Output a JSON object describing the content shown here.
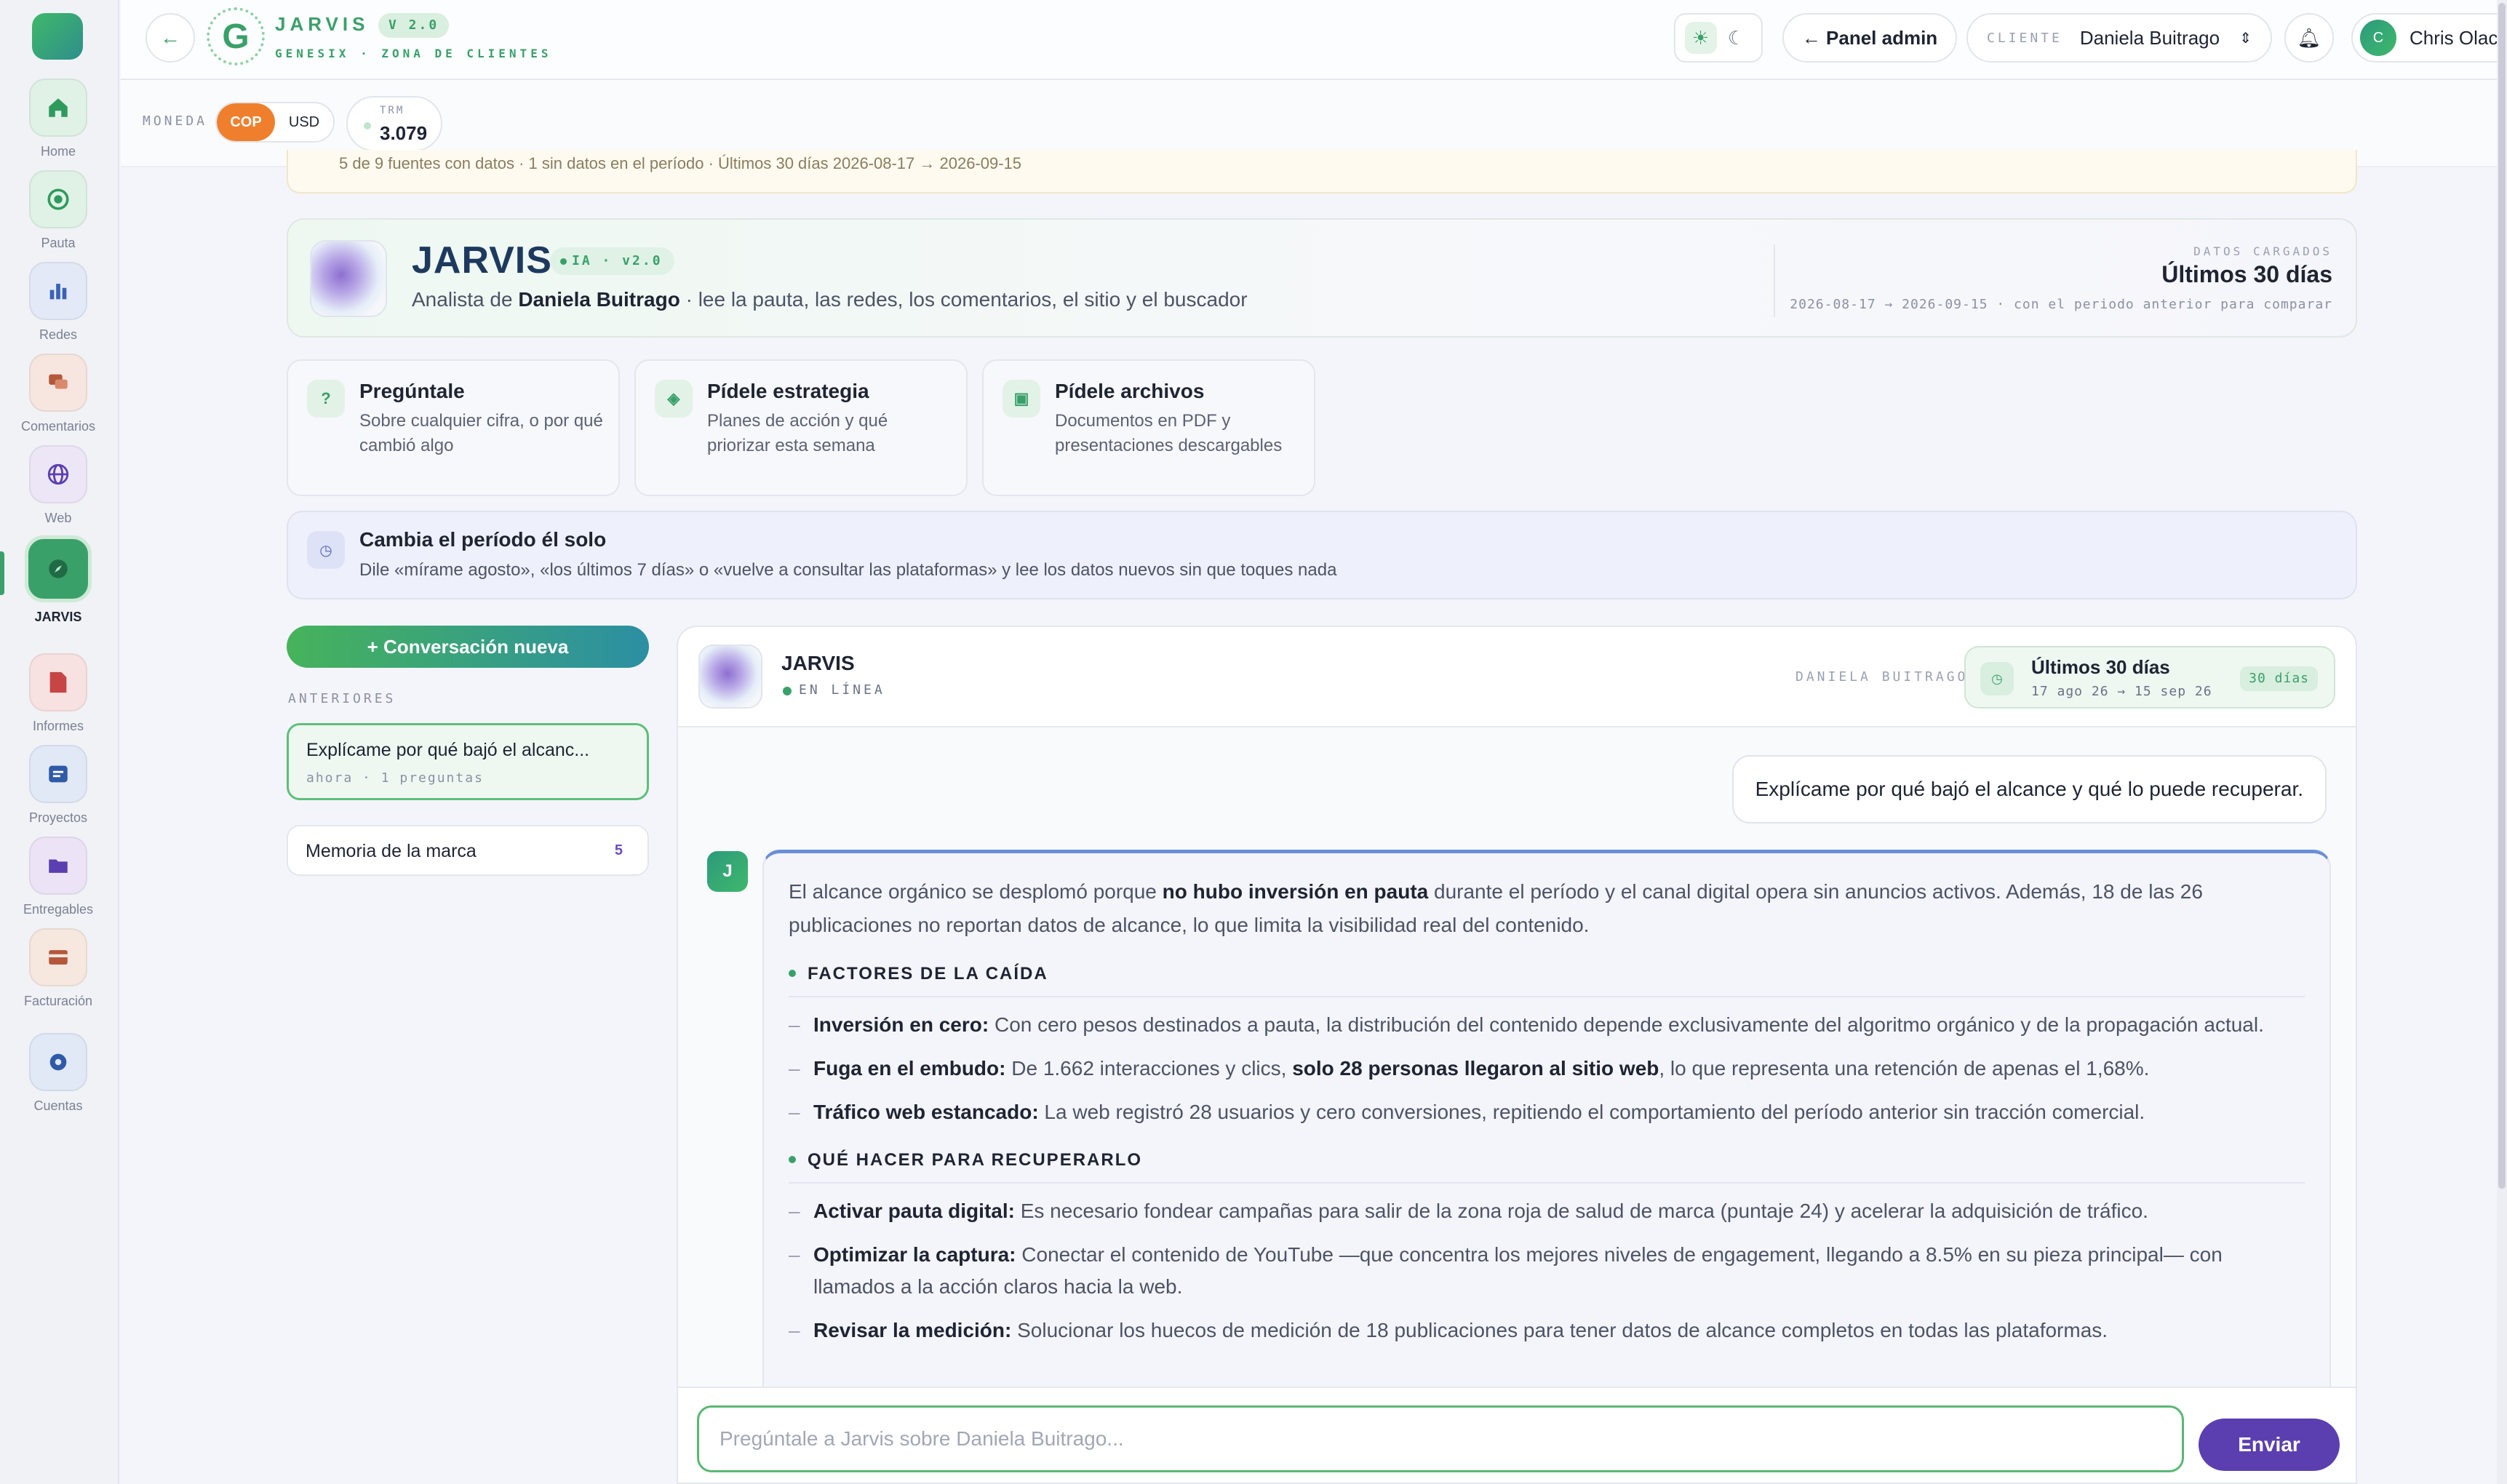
{
  "sidebar": {
    "items": [
      {
        "label": "Home",
        "icon": "home-icon",
        "color": "#dff2e5"
      },
      {
        "label": "Pauta",
        "icon": "target-icon",
        "color": "#dff2e5"
      },
      {
        "label": "Redes",
        "icon": "bar-chart-icon",
        "color": "#e3e9f6"
      },
      {
        "label": "Comentarios",
        "icon": "chat-bubbles-icon",
        "color": "#f7e5df"
      },
      {
        "label": "Web",
        "icon": "globe-icon",
        "color": "#ece6f6"
      },
      {
        "label": "JARVIS",
        "icon": "compass-icon",
        "color": "#3aa06a"
      },
      {
        "label": "Informes",
        "icon": "document-icon",
        "color": "#f7e1e1"
      },
      {
        "label": "Proyectos",
        "icon": "folder-list-icon",
        "color": "#e1e8f6"
      },
      {
        "label": "Entregables",
        "icon": "folder-icon",
        "color": "#ece4f6"
      },
      {
        "label": "Facturación",
        "icon": "card-icon",
        "color": "#f6e7df"
      },
      {
        "label": "Cuentas",
        "icon": "gear-icon",
        "color": "#e1e8f6"
      }
    ]
  },
  "topbar": {
    "brand_letter": "G",
    "brand_title": "JARVIS",
    "brand_version": "V 2.0",
    "brand_subtitle": "GENESIX · ZONA DE CLIENTES",
    "admin_label": "← Panel admin",
    "client_label": "CLIENTE",
    "client_value": "Daniela Buitrago",
    "user_initial": "C",
    "user_name": "Chris Olaciregui"
  },
  "currency": {
    "label": "MONEDA",
    "options": [
      "COP",
      "USD"
    ],
    "selected": "COP",
    "trm_label": "TRM",
    "trm_value": "3.079"
  },
  "notice": "5 de 9 fuentes con datos · 1 sin datos en el período · Últimos 30 días 2026-08-17 → 2026-09-15",
  "hero": {
    "title": "JARVIS",
    "tag": "IA · v2.0",
    "subtitle_pre": "Analista de ",
    "subtitle_name": "Daniela Buitrago",
    "subtitle_post": " · lee la pauta, las redes, los comentarios, el sitio y el buscador",
    "data_label": "DATOS CARGADOS",
    "data_value": "Últimos 30 días",
    "data_range": "2026-08-17 → 2026-09-15 · con el periodo anterior para comparar"
  },
  "capabilities": [
    {
      "icon": "?",
      "title": "Pregúntale",
      "desc": "Sobre cualquier cifra, o por qué cambió algo"
    },
    {
      "icon": "◈",
      "title": "Pídele estrategia",
      "desc": "Planes de acción y qué priorizar esta semana"
    },
    {
      "icon": "▣",
      "title": "Pídele archivos",
      "desc": "Documentos en PDF y presentaciones descargables"
    }
  ],
  "period_tip": {
    "title": "Cambia el período él solo",
    "desc": "Dile «mírame agosto», «los últimos 7 días» o «vuelve a consultar las plataformas» y lee los datos nuevos sin que toques nada"
  },
  "conversations": {
    "new_label": "+ Conversación nueva",
    "previous_label": "ANTERIORES",
    "items": [
      {
        "title": "Explícame por qué bajó el alcanc...",
        "meta": "ahora · 1 preguntas"
      }
    ],
    "memory_label": "Memoria de la marca",
    "memory_count": "5"
  },
  "chat": {
    "name": "JARVIS",
    "status": "EN LÍNEA",
    "client": "DANIELA BUITRAGO",
    "period_title": "Últimos 30 días",
    "period_range": "17 ago 26 → 15 sep 26",
    "period_badge": "30 días",
    "user_message": "Explícame por qué bajó el alcance y qué lo puede recuperar.",
    "bot_initial": "J",
    "lead_pre": "El alcance orgánico se desplomó porque ",
    "lead_bold": "no hubo inversión en pauta",
    "lead_post": " durante el período y el canal digital opera sin anuncios activos. Además, 18 de las 26 publicaciones no reportan datos de alcance, lo que limita la visibilidad real del contenido.",
    "section1": "FACTORES DE LA CAÍDA",
    "s1_b1_bold": "Inversión en cero:",
    "s1_b1": " Con cero pesos destinados a pauta, la distribución del contenido depende exclusivamente del algoritmo orgánico y de la propagación actual.",
    "s1_b2_bold": "Fuga en el embudo:",
    "s1_b2_a": " De 1.662 interacciones y clics, ",
    "s1_b2_bold2": "solo 28 personas llegaron al sitio web",
    "s1_b2_b": ", lo que representa una retención de apenas el 1,68%.",
    "s1_b3_bold": "Tráfico web estancado:",
    "s1_b3": " La web registró 28 usuarios y cero conversiones, repitiendo el comportamiento del período anterior sin tracción comercial.",
    "section2": "QUÉ HACER PARA RECUPERARLO",
    "s2_b1_bold": "Activar pauta digital:",
    "s2_b1": " Es necesario fondear campañas para salir de la zona roja de salud de marca (puntaje 24) y acelerar la adquisición de tráfico.",
    "s2_b2_bold": "Optimizar la captura:",
    "s2_b2": " Conectar el contenido de YouTube —que concentra los mejores niveles de engagement, llegando a 8.5% en su pieza principal— con llamados a la acción claros hacia la web.",
    "s2_b3_bold": "Revisar la medición:",
    "s2_b3": " Solucionar los huecos de medición de 18 publicaciones para tener datos de alcance completos en todas las plataformas.",
    "input_placeholder": "Pregúntale a Jarvis sobre Daniela Buitrago...",
    "send_label": "Enviar"
  }
}
